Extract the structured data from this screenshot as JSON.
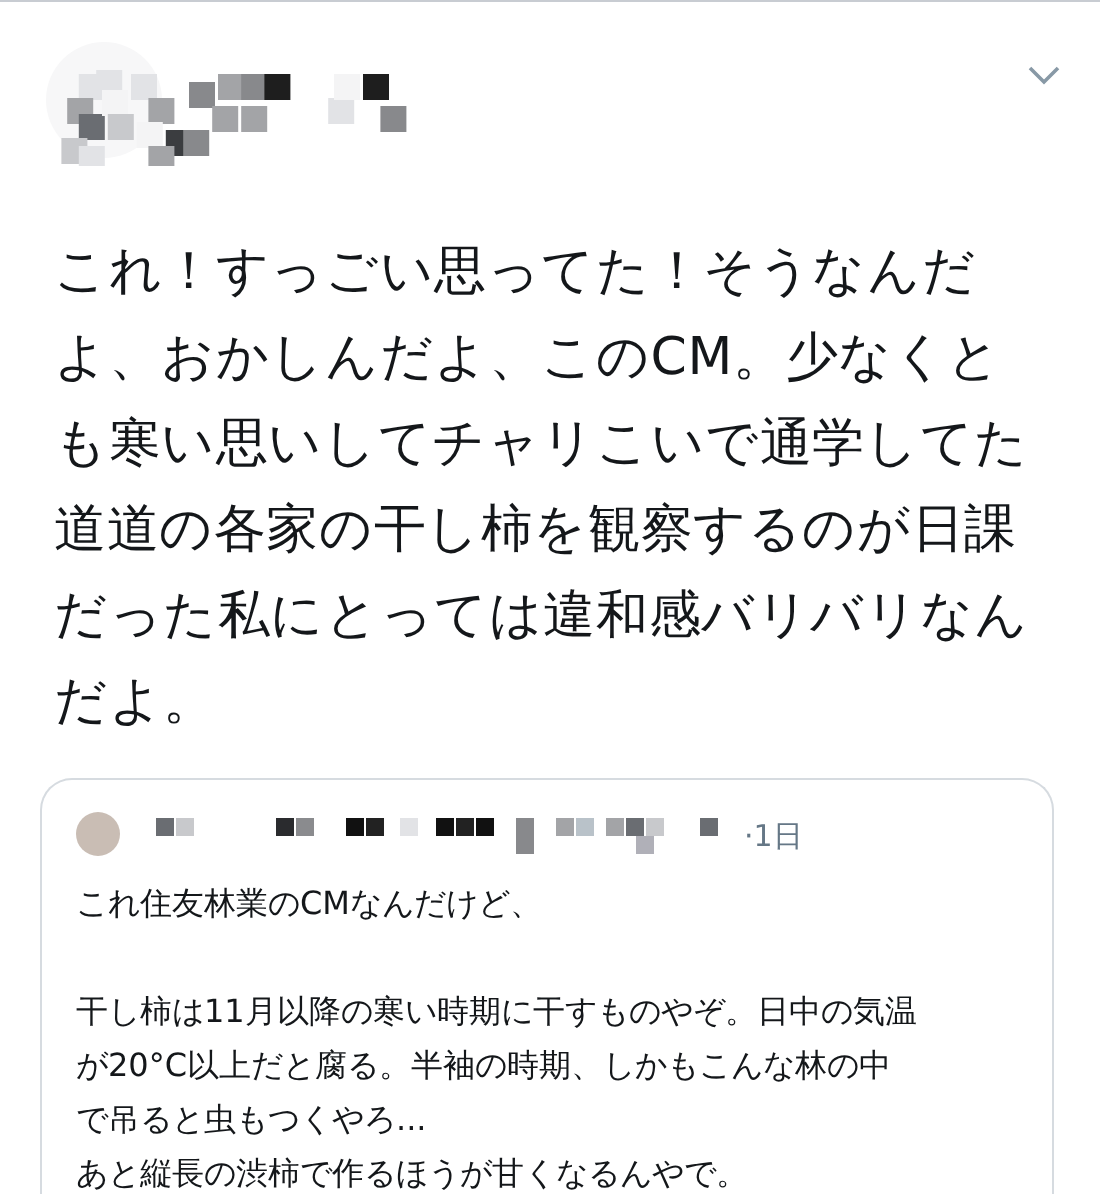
{
  "tweet": {
    "body_lines": [
      "これ！すっごい思ってた！そうなんだ",
      "よ、おかしんだよ、このCM。少なくと",
      "も寒い思いしてチャリこいで通学してた",
      "道道の各家の干し柿を観察するのが日課",
      "だった私にとっては違和感バリバリなん",
      "だよ。"
    ]
  },
  "quoted_tweet": {
    "time": "·1日",
    "paragraphs": [
      [
        "これ住友林業のCMなんだけど、"
      ],
      [
        "干し柿は11月以降の寒い時期に干すものやぞ。日中の気温",
        "が20°C以上だと腐る。半袖の時期、しかもこんな林の中",
        "で吊ると虫もつくやろ...",
        "あと縦長の渋柿で作るほうが甘くなるんやで。"
      ]
    ]
  }
}
